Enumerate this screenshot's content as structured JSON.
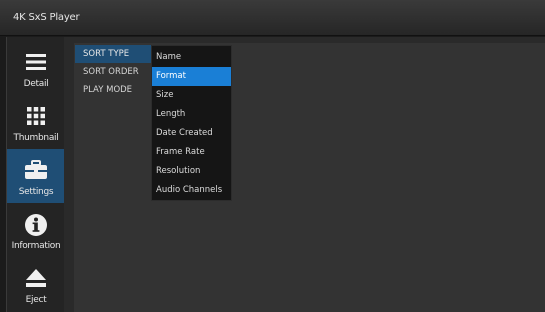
{
  "window": {
    "title": "4K SxS Player"
  },
  "sidebar": {
    "items": [
      {
        "label": "Detail",
        "icon": "list-icon",
        "active": false
      },
      {
        "label": "Thumbnail",
        "icon": "grid-icon",
        "active": false
      },
      {
        "label": "Settings",
        "icon": "toolbox-icon",
        "active": true
      },
      {
        "label": "Information",
        "icon": "info-icon",
        "active": false
      },
      {
        "label": "Eject",
        "icon": "eject-icon",
        "active": false
      }
    ]
  },
  "settings_menu": {
    "items": [
      {
        "label": "SORT TYPE",
        "selected": true
      },
      {
        "label": "SORT ORDER",
        "selected": false
      },
      {
        "label": "PLAY MODE",
        "selected": false
      }
    ]
  },
  "sort_type_dropdown": {
    "highlighted": "Format",
    "options": [
      "Name",
      "Format",
      "Size",
      "Length",
      "Date Created",
      "Frame Rate",
      "Resolution",
      "Audio Channels"
    ]
  },
  "colors": {
    "accent_selected": "#1f4e75",
    "highlight": "#1a7fd6"
  }
}
